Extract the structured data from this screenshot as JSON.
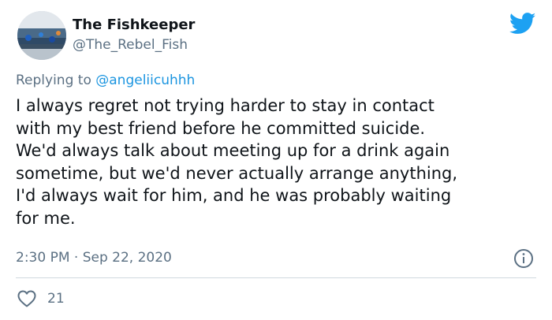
{
  "author": {
    "display_name": "The Fishkeeper",
    "handle": "@The_Rebel_Fish"
  },
  "reply": {
    "prefix": "Replying to ",
    "target": "@angeliicuhhh"
  },
  "tweet_text": "I always regret not trying harder to stay in contact\nwith my best friend before he committed suicide.\nWe'd always talk about meeting up for a drink again\nsometime, but we'd never actually arrange anything,\nI'd always wait for him, and he was probably waiting\nfor me.",
  "meta": {
    "time": "2:30 PM",
    "separator": " · ",
    "date": "Sep 22, 2020"
  },
  "likes": {
    "count": "21"
  },
  "icons": {
    "brand": "bird-icon",
    "info": "info-icon",
    "like": "heart-icon"
  },
  "colors": {
    "brand_blue": "#1da1f2",
    "link_blue": "#1b95e0",
    "muted_text": "#5b7083",
    "divider": "#cfd9de"
  }
}
